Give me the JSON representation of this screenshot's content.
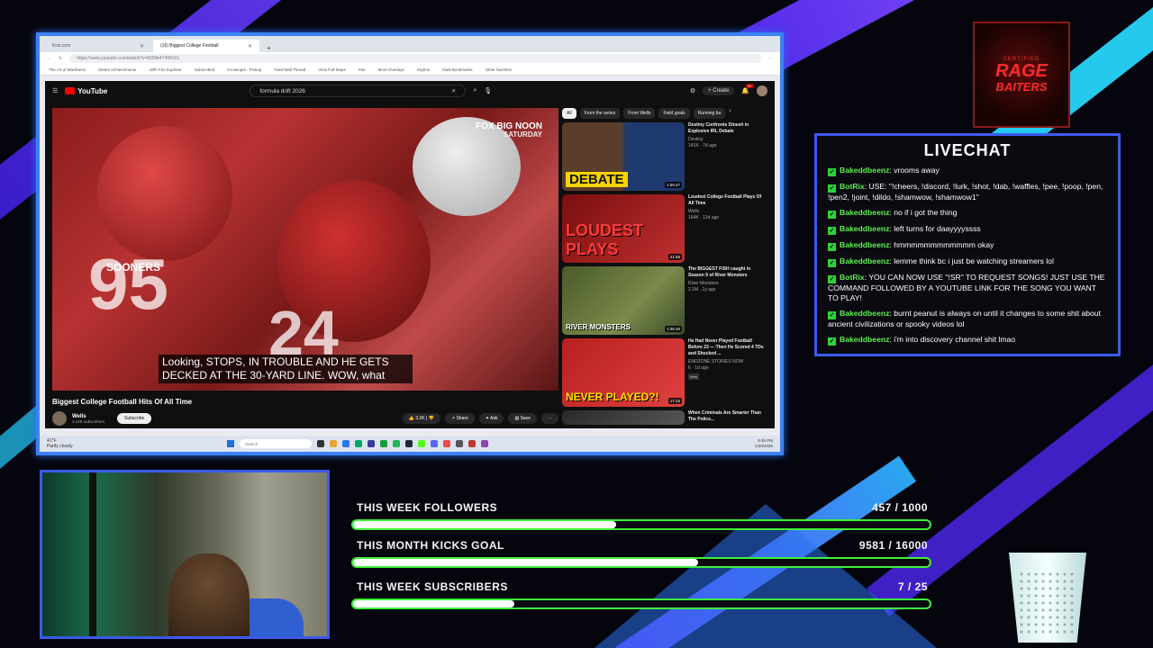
{
  "browser": {
    "tabs": [
      {
        "label": "Kick.com"
      },
      {
        "label": "(16) Biggest College Football"
      }
    ],
    "url": "https://www.youtube.com/watch?v=M2Nb4T4WVZs",
    "bookmarks": [
      "The Art of Manliness",
      "Steam Achievements",
      "Jeffs Fire Explorer",
      "Subscribed",
      "Growtopia - Pickup",
      "Toad Wall Thread",
      "View Full Maps",
      "Site",
      "More Overlays",
      "Skyline",
      "Dark Bookmarks",
      "Other favorites"
    ]
  },
  "youtube": {
    "brand": "YouTube",
    "search_query": "formula drift 2026",
    "create_label": "Create",
    "notification_count": "9+",
    "video": {
      "title": "Biggest College Football Hits Of All Time",
      "caption": "Looking, STOPS, IN TROUBLE AND HE GETS DECKED AT THE 30-YARD LINE. WOW, what",
      "overlay_brand": "FOX BIG NOON",
      "overlay_sub": "SATURDAY",
      "jersey_text": "SOONERS",
      "jersey_num_1": "95",
      "jersey_num_2": "24"
    },
    "channel": {
      "name": "Wells",
      "subs": "3.44K subscribers",
      "subscribe_label": "Subscribe"
    },
    "actions": {
      "likes": "3.2K",
      "share": "Share",
      "ask": "Ask",
      "save": "Save"
    },
    "chips": [
      "All",
      "From the series",
      "From Wells",
      "Field goals",
      "Running ba"
    ],
    "recommendations": [
      {
        "title": "Destiny Confronts Dinesh in Explosive IRL Debate",
        "channel": "Destiny",
        "views": "141K · 7d ago",
        "thumb_text": "DEBATE",
        "duration": "1:56:47"
      },
      {
        "title": "Loudest College Football Plays Of All Time",
        "channel": "Wells",
        "views": "164K · 12d ago",
        "thumb_text": "LOUDEST PLAYS",
        "duration": "21:58"
      },
      {
        "title": "The BIGGEST FISH caught in Season 9 of River Monsters",
        "channel": "River Monsters",
        "views": "2.1M · 1y ago",
        "thumb_text": "RIVER MONSTERS",
        "duration": "1:05:48"
      },
      {
        "title": "He Had Never Played Football Before 23 — Then He Scored 4 TDs and Shocked ...",
        "channel": "ENDZONE STORIES NOW",
        "views": "6 · 1d ago",
        "thumb_text": "NEVER PLAYED?!",
        "duration": "17:15",
        "badge": "New"
      },
      {
        "title": "When Criminals Are Smarter Than The Police...",
        "channel": "",
        "views": "",
        "thumb_text": "",
        "duration": ""
      }
    ]
  },
  "taskbar": {
    "weather": "41°F",
    "weather_sub": "Partly cloudy",
    "search": "Search",
    "time": "9:45 PM",
    "date": "1/30/2026"
  },
  "logo": {
    "top": "CERTIFIED",
    "main": "RAGE",
    "sub": "BAITERS"
  },
  "livechat": {
    "title": "LIVECHAT",
    "messages": [
      {
        "user": "Bakeddbeenz",
        "text": "vrooms away"
      },
      {
        "user": "BotRix",
        "text": "USE: \"!cheers, !discord, !lurk, !shot, !dab, !waffles, !pee, !poop, !pen, !pen2, !joint, !dildo, !shamwow, !shamwow1\""
      },
      {
        "user": "Bakeddbeenz",
        "text": "no if i got the thing"
      },
      {
        "user": "Bakeddbeenz",
        "text": "left turns for daayyyyssss"
      },
      {
        "user": "Bakeddbeenz",
        "text": "hmmmmmmmmmmmm okay"
      },
      {
        "user": "Bakeddbeenz",
        "text": "lemme think bc i just be watching streamers lol"
      },
      {
        "user": "BotRix",
        "text": "YOU CAN NOW USE \"!SR\" TO REQUEST SONGS! JUST USE THE COMMAND FOLLOWED BY A YOUTUBE LINK FOR THE SONG YOU WANT TO PLAY!"
      },
      {
        "user": "Bakeddbeenz",
        "text": "burnt peanut is always on until it changes to some shit about ancient civilizations or spooky videos lol"
      },
      {
        "user": "Bakeddbeenz",
        "text": "i'm into discovery channel shit lmao"
      }
    ]
  },
  "goals": [
    {
      "label": "THIS WEEK FOLLOWERS",
      "value": "457 / 1000",
      "fraction": 0.457
    },
    {
      "label": "THIS MONTH KICKS GOAL",
      "value": "9581 / 16000",
      "fraction": 0.599
    },
    {
      "label": "THIS WEEK SUBSCRIBERS",
      "value": "7 / 25",
      "fraction": 0.28
    }
  ],
  "colors": {
    "accent_blue": "#3b5bf0",
    "goal_green": "#3ff03a",
    "chat_user": "#5ef04f",
    "yt_red": "#ff0000"
  }
}
